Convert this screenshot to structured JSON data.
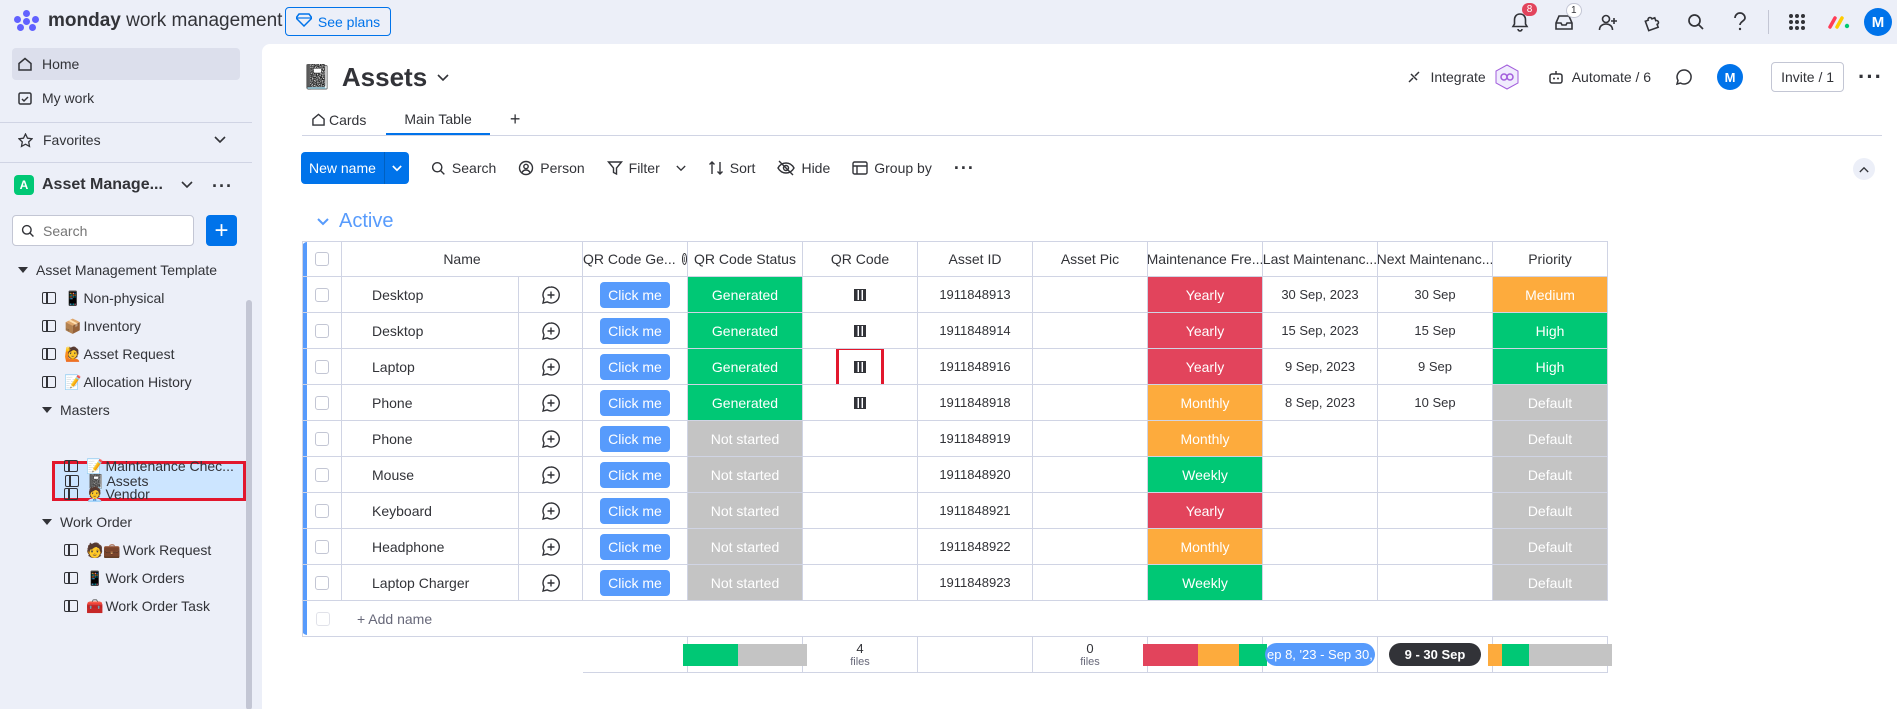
{
  "app": {
    "brand_bold": "monday",
    "brand_rest": " work management",
    "see_plans": "See plans",
    "notif_count": "8",
    "inbox_count": "1",
    "avatar": "M"
  },
  "sidebar": {
    "home": "Home",
    "my_work": "My work",
    "favorites": "Favorites",
    "workspace_badge": "A",
    "workspace": "Asset Manage...",
    "search_placeholder": "Search",
    "template": "Asset Management Template",
    "boards": [
      {
        "emoji": "📱",
        "label": "Non-physical"
      },
      {
        "emoji": "📦",
        "label": "Inventory"
      },
      {
        "emoji": "🙋",
        "label": "Asset Request"
      },
      {
        "emoji": "📝",
        "label": "Allocation History"
      }
    ],
    "masters_folder": "Masters",
    "masters": [
      {
        "emoji": "📓",
        "label": "Assets"
      },
      {
        "emoji": "📝",
        "label": "Maintenance Chec..."
      },
      {
        "emoji": "🧑‍💼",
        "label": "Vendor"
      }
    ],
    "work_order_folder": "Work Order",
    "work_order": [
      {
        "emoji": "🧑💼",
        "label": "Work Request"
      },
      {
        "emoji": "📱",
        "label": "Work Orders"
      },
      {
        "emoji": "🧰",
        "label": "Work Order Task"
      }
    ]
  },
  "board": {
    "icon": "📓",
    "title": "Assets",
    "integrate": "Integrate",
    "automate": "Automate / 6",
    "invite": "Invite / 1",
    "tabs": [
      {
        "label": "Cards"
      },
      {
        "label": "Main Table"
      }
    ],
    "toolbar": {
      "new": "New name",
      "search": "Search",
      "person": "Person",
      "filter": "Filter",
      "sort": "Sort",
      "hide": "Hide",
      "group_by": "Group by"
    },
    "group": "Active",
    "columns": [
      "Name",
      "QR Code Ge...",
      "QR Code Status",
      "QR Code",
      "Asset ID",
      "Asset Pic",
      "Maintenance Fre...",
      "Last Maintenanc...",
      "Next Maintenanc...",
      "Priority"
    ],
    "click_me": "Click me",
    "rows": [
      {
        "name": "Desktop",
        "status": "Generated",
        "qr": true,
        "id": "1911848913",
        "freq": "Yearly",
        "last": "30 Sep, 2023",
        "next": "30 Sep",
        "priority": "Medium"
      },
      {
        "name": "Desktop",
        "status": "Generated",
        "qr": true,
        "id": "1911848914",
        "freq": "Yearly",
        "last": "15 Sep, 2023",
        "next": "15 Sep",
        "priority": "High"
      },
      {
        "name": "Laptop",
        "status": "Generated",
        "qr": true,
        "id": "1911848916",
        "freq": "Yearly",
        "last": "9 Sep, 2023",
        "next": "9 Sep",
        "priority": "High"
      },
      {
        "name": "Phone",
        "status": "Generated",
        "qr": true,
        "id": "1911848918",
        "freq": "Monthly",
        "last": "8 Sep, 2023",
        "next": "10 Sep",
        "priority": "Default"
      },
      {
        "name": "Phone",
        "status": "Not started",
        "qr": false,
        "id": "1911848919",
        "freq": "Monthly",
        "last": "",
        "next": "",
        "priority": "Default"
      },
      {
        "name": "Mouse",
        "status": "Not started",
        "qr": false,
        "id": "1911848920",
        "freq": "Weekly",
        "last": "",
        "next": "",
        "priority": "Default"
      },
      {
        "name": "Keyboard",
        "status": "Not started",
        "qr": false,
        "id": "1911848921",
        "freq": "Yearly",
        "last": "",
        "next": "",
        "priority": "Default"
      },
      {
        "name": "Headphone",
        "status": "Not started",
        "qr": false,
        "id": "1911848922",
        "freq": "Monthly",
        "last": "",
        "next": "",
        "priority": "Default"
      },
      {
        "name": "Laptop Charger",
        "status": "Not started",
        "qr": false,
        "id": "1911848923",
        "freq": "Weekly",
        "last": "",
        "next": "",
        "priority": "Default"
      }
    ],
    "add_name": "+ Add name",
    "summary": {
      "qr_count": "4",
      "qr_unit": "files",
      "pic_count": "0",
      "pic_unit": "files",
      "last_range": "ep 8, '23 - Sep 30, '",
      "next_range": "9 - 30 Sep"
    }
  },
  "colors": {
    "Generated": "#00c875",
    "Not started": "#c4c4c4",
    "Yearly": "#e2445c",
    "Monthly": "#fdab3d",
    "Weekly": "#00c875",
    "Medium": "#fdab3d",
    "High": "#00c875",
    "Default": "#c4c4c4"
  }
}
